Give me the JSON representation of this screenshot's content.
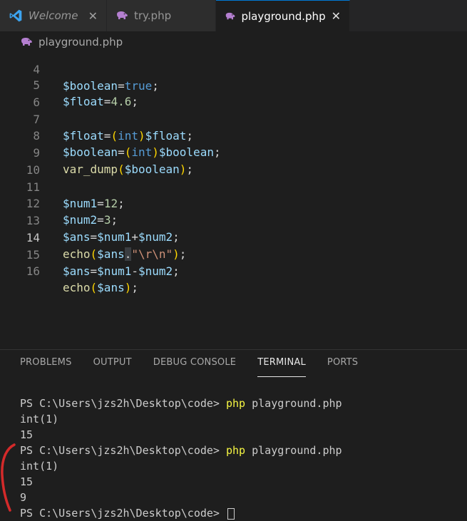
{
  "tabs": [
    {
      "label": "Welcome",
      "icon": "vscode-icon",
      "close": "✕"
    },
    {
      "label": "try.php",
      "icon": "php-elephant-icon",
      "close": ""
    },
    {
      "label": "playground.php",
      "icon": "php-elephant-icon",
      "close": "✕"
    }
  ],
  "colors": {
    "active_tab_accent": "#0078d4",
    "php_icon": "#b47fd0",
    "annotation": "#d42a2a"
  },
  "breadcrumb": {
    "file": "playground.php",
    "icon": "php-elephant-icon"
  },
  "editor": {
    "current_line": "14",
    "lines": [
      {
        "num": "4",
        "text": "$boolean=true;"
      },
      {
        "num": "5",
        "text": "$float=4.6;"
      },
      {
        "num": "6",
        "text": ""
      },
      {
        "num": "7",
        "text": "$float=(int)$float;"
      },
      {
        "num": "8",
        "text": "$boolean=(int)$boolean;"
      },
      {
        "num": "9",
        "text": "var_dump($boolean);"
      },
      {
        "num": "10",
        "text": ""
      },
      {
        "num": "11",
        "text": "$num1=12;"
      },
      {
        "num": "12",
        "text": "$num2=3;"
      },
      {
        "num": "13",
        "text": "$ans=$num1+$num2;"
      },
      {
        "num": "14",
        "text": "echo($ans.\"\\r\\n\");"
      },
      {
        "num": "15",
        "text": "$ans=$num1-$num2;"
      },
      {
        "num": "16",
        "text": "echo($ans);"
      }
    ]
  },
  "panel": {
    "tabs": [
      "PROBLEMS",
      "OUTPUT",
      "DEBUG CONSOLE",
      "TERMINAL",
      "PORTS"
    ],
    "active_tab": "TERMINAL"
  },
  "terminal": {
    "prompt": "PS C:\\Users\\jzs2h\\Desktop\\code> ",
    "command": "php playground.php",
    "lines": [
      {
        "type": "command",
        "prompt": "PS C:\\Users\\jzs2h\\Desktop\\code> ",
        "cmd": "php",
        "args": " playground.php"
      },
      {
        "type": "output",
        "text": "int(1)"
      },
      {
        "type": "output",
        "text": "15"
      },
      {
        "type": "command",
        "prompt": "PS C:\\Users\\jzs2h\\Desktop\\code> ",
        "cmd": "php",
        "args": " playground.php"
      },
      {
        "type": "output",
        "text": "int(1)"
      },
      {
        "type": "output",
        "text": "15"
      },
      {
        "type": "output",
        "text": "9"
      },
      {
        "type": "prompt",
        "prompt": "PS C:\\Users\\jzs2h\\Desktop\\code> "
      }
    ]
  }
}
